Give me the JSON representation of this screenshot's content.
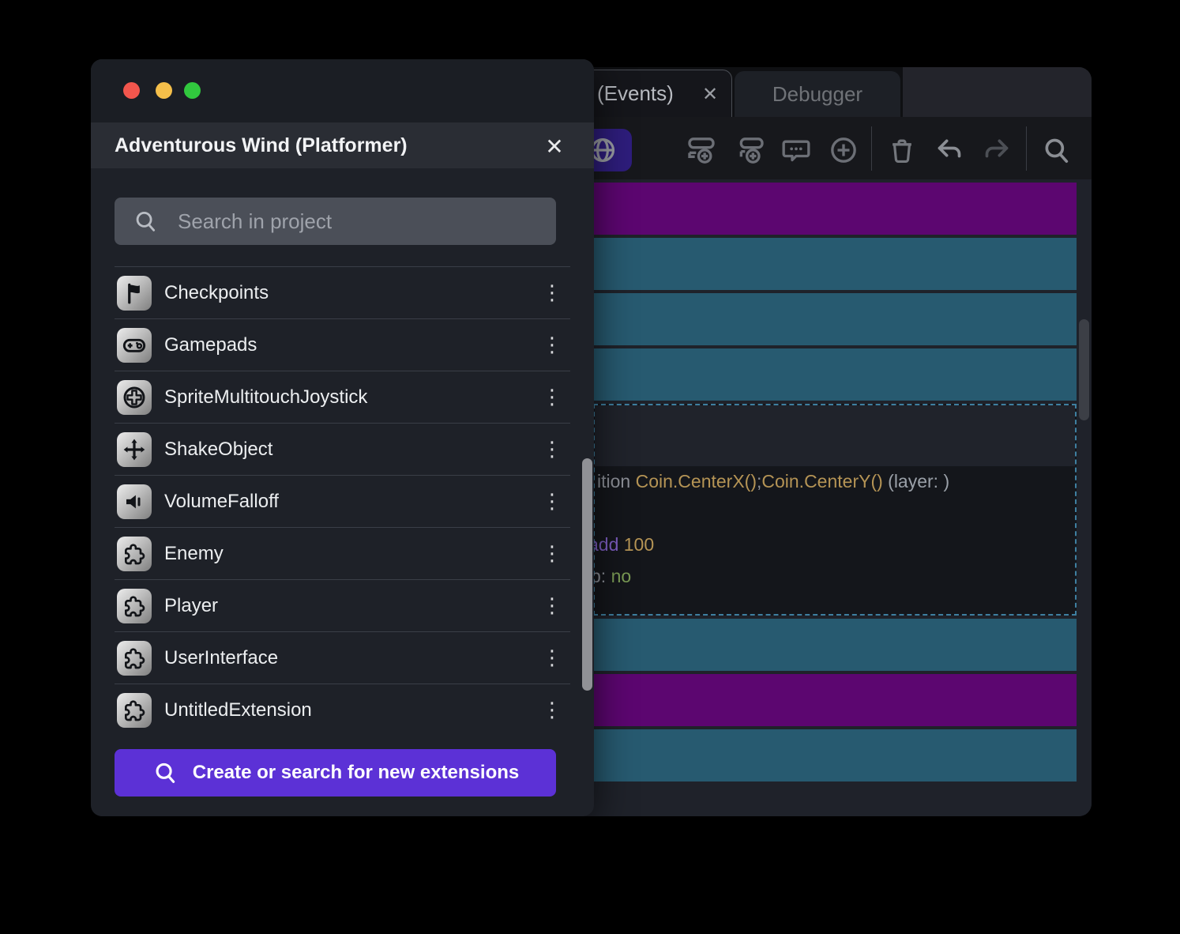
{
  "dialog": {
    "title": "Adventurous Wind (Platformer)",
    "search": {
      "placeholder": "Search in project"
    },
    "items": [
      {
        "label": "Checkpoints",
        "icon": "flag-icon"
      },
      {
        "label": "Gamepads",
        "icon": "gamepad-icon"
      },
      {
        "label": "SpriteMultitouchJoystick",
        "icon": "joystick-icon"
      },
      {
        "label": "ShakeObject",
        "icon": "move-icon"
      },
      {
        "label": "VolumeFalloff",
        "icon": "speaker-icon"
      },
      {
        "label": "Enemy",
        "icon": "puzzle-icon"
      },
      {
        "label": "Player",
        "icon": "puzzle-icon"
      },
      {
        "label": "UserInterface",
        "icon": "puzzle-icon"
      },
      {
        "label": "UntitledExtension",
        "icon": "puzzle-icon"
      }
    ],
    "create_button_label": "Create or search for new extensions"
  },
  "window": {
    "tabs": [
      {
        "label": "(Events)",
        "active": true
      },
      {
        "label": "Debugger",
        "active": false
      }
    ],
    "events": {
      "rows_top": [
        "purple",
        "teal",
        "teal",
        "teal"
      ],
      "rows_bottom": [
        "teal",
        "purple",
        "teal"
      ],
      "selected": {
        "line1": [
          {
            "text": "ition ",
            "color": "gray"
          },
          {
            "text": "Coin.CenterX()",
            "color": "gold"
          },
          {
            "text": ";",
            "color": "gray"
          },
          {
            "text": "Coin.CenterY()",
            "color": "gold"
          },
          {
            "text": " (layer: )",
            "color": "light"
          }
        ],
        "line2": [
          {
            "text": "add ",
            "color": "purple"
          },
          {
            "text": "100",
            "color": "gold"
          }
        ],
        "line3": [
          {
            "text": "p: ",
            "color": "gray"
          },
          {
            "text": "no",
            "color": "green"
          }
        ]
      }
    }
  },
  "icons": {
    "close_glyph": "✕",
    "tab_close_glyph": "✕",
    "kebab_glyph": "⋮"
  },
  "colors": {
    "purple_row": "#5c0670",
    "teal_row": "#275a70",
    "accent_button": "#5c31d6",
    "traffic_red": "#f2564d",
    "traffic_yellow": "#f5bf4a",
    "traffic_green": "#31c83e",
    "token": {
      "gray": "#8d9098",
      "gold": "#b59455",
      "purple": "#7e5ec2",
      "green": "#7b9c55",
      "light": "#9aa0a8"
    }
  }
}
